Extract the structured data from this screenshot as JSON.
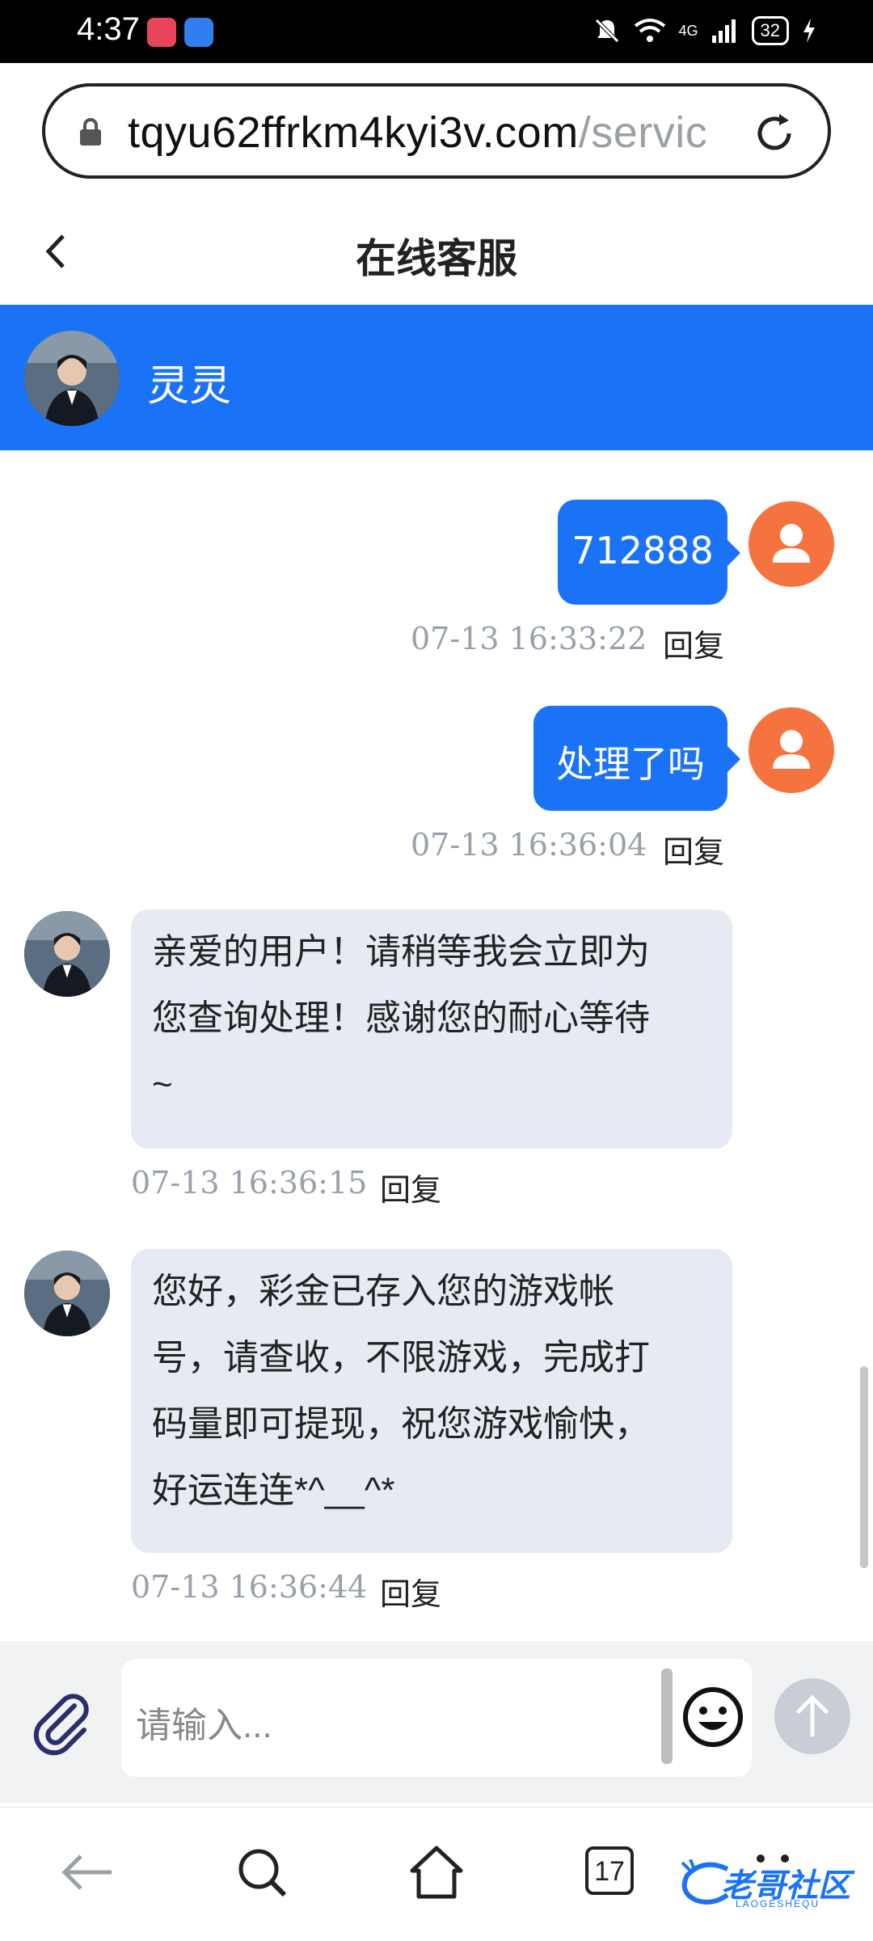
{
  "status": {
    "time": "4:37",
    "network": "4G",
    "battery": "32"
  },
  "browser": {
    "url_domain": "tqyu62ffrkm4kyi3v.com",
    "url_path": "/servic"
  },
  "page": {
    "title": "在线客服"
  },
  "agent": {
    "name": "灵灵"
  },
  "messages": [
    {
      "from": "user",
      "text": "712888",
      "time": "07-13 16:33:22",
      "reply": "回复"
    },
    {
      "from": "user",
      "text": "处理了吗",
      "time": "07-13 16:36:04",
      "reply": "回复"
    },
    {
      "from": "agent",
      "lines": [
        "亲爱的用户！请稍等我会立即为",
        "您查询处理！感谢您的耐心等待",
        "~"
      ],
      "time": "07-13 16:36:15",
      "reply": "回复"
    },
    {
      "from": "agent",
      "lines": [
        "您好，彩金已存入您的游戏帐",
        "号，请查收，不限游戏，完成打",
        "码量即可提现，祝您游戏愉快，",
        "好运连连*^__^*"
      ],
      "time": "07-13 16:36:44",
      "reply": "回复"
    }
  ],
  "composer": {
    "placeholder": "请输入..."
  },
  "nav": {
    "tabs_count": "17"
  },
  "watermark": {
    "text": "老哥社区",
    "subtext": "LAOGESHEQU"
  },
  "colors": {
    "accent": "#1a73f7",
    "user_avatar": "#f5733e",
    "agent_bubble": "#e6eaf2"
  }
}
